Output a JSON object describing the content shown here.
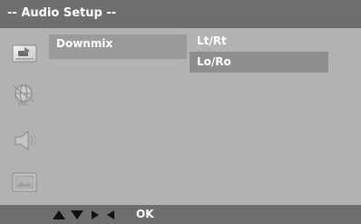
{
  "title": "-- Audio Setup --",
  "menu": {
    "items": [
      {
        "label": "Downmix"
      }
    ]
  },
  "options": [
    {
      "label": "Lt/Rt",
      "selected": false
    },
    {
      "label": "Lo/Ro",
      "selected": true
    }
  ],
  "sidebar": {
    "icons": [
      {
        "name": "general-setup-icon",
        "active": true
      },
      {
        "name": "language-globe-icon",
        "active": false
      },
      {
        "name": "audio-speaker-icon",
        "active": false
      },
      {
        "name": "video-screen-icon",
        "active": false
      }
    ]
  },
  "footer": {
    "nav_icons": [
      "up-arrow-icon",
      "down-arrow-icon",
      "right-arrow-icon",
      "left-arrow-icon"
    ],
    "ok_label": "OK"
  },
  "colors": {
    "background": "#b2b2b2",
    "bar": "#6e6e6e",
    "highlight": "#9a9a9a",
    "selected_option": "#8e8e8e",
    "text": "#ffffff",
    "arrow": "#111111"
  }
}
